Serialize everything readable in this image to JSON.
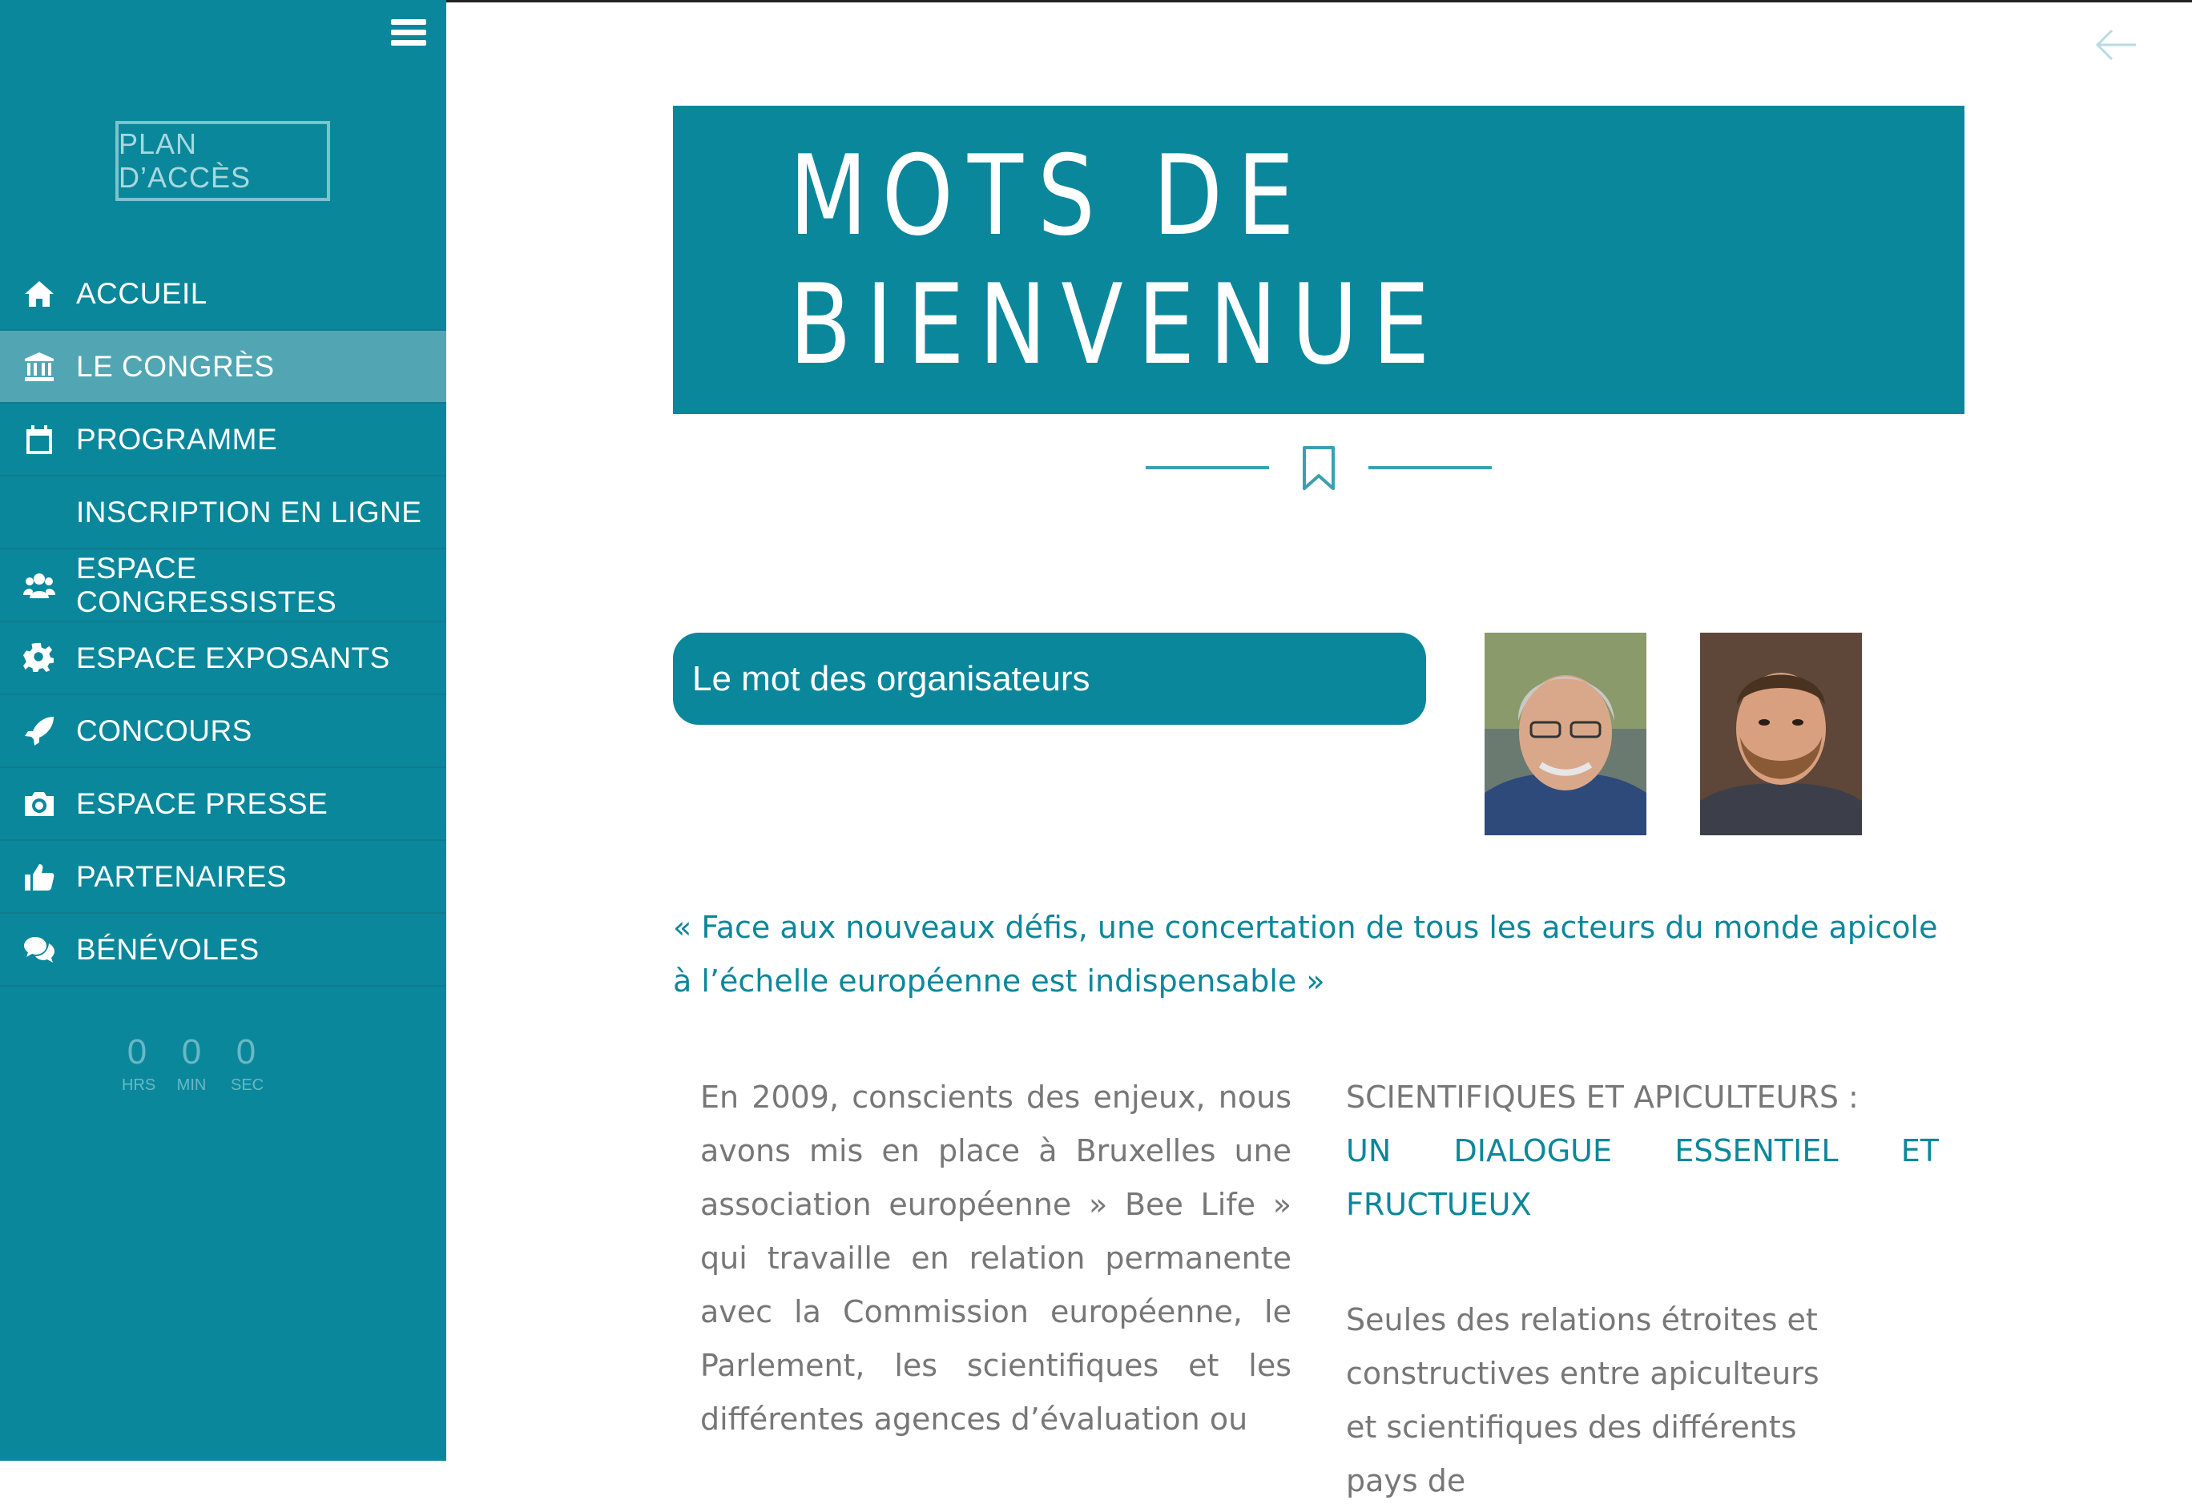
{
  "sidebar": {
    "plan_button": "PLAN D’ACCÈS",
    "items": [
      {
        "label": "ACCUEIL",
        "icon": "home-icon",
        "active": false
      },
      {
        "label": "LE CONGRÈS",
        "icon": "institution-icon",
        "active": true
      },
      {
        "label": "PROGRAMME",
        "icon": "calendar-icon",
        "active": false
      },
      {
        "label": "INSCRIPTION EN LIGNE",
        "icon": "",
        "active": false
      },
      {
        "label": "ESPACE CONGRESSISTES",
        "icon": "users-icon",
        "active": false
      },
      {
        "label": "ESPACE EXPOSANTS",
        "icon": "gear-icon",
        "active": false
      },
      {
        "label": "CONCOURS",
        "icon": "rocket-icon",
        "active": false
      },
      {
        "label": "ESPACE PRESSE",
        "icon": "camera-icon",
        "active": false
      },
      {
        "label": "PARTENAIRES",
        "icon": "thumbs-up-icon",
        "active": false
      },
      {
        "label": "BÉNÉVOLES",
        "icon": "chat-bubbles-icon",
        "active": false
      }
    ],
    "countdown": {
      "hours": "0",
      "hours_label": "HRS",
      "minutes": "0",
      "minutes_label": "MIN",
      "seconds": "0",
      "seconds_label": "SEC"
    }
  },
  "main": {
    "page_title": "MOTS DE BIENVENUE",
    "section_title": "Le mot des organisateurs",
    "quote": "« Face aux nouveaux défis, une concertation de tous les acteurs du monde apicole à l’échelle européenne est indispensable »",
    "left_column": "En 2009, conscients des enjeux, nous avons mis en place à Bruxelles une association européenne » Bee Life » qui travaille en relation permanente avec la Commission européenne, le Parlement, les scientifiques et les différentes agences d’évaluation ou",
    "right_column": {
      "heading_1": "SCIENTIFIQUES ET APICULTEURS :",
      "heading_2": "UN DIALOGUE ESSENTIEL ET FRUCTUEUX",
      "body": "Seules des relations étroites et constructives entre apiculteurs et scientifiques des différents pays de"
    }
  },
  "colors": {
    "brand": "#0b879b",
    "sidebar_active": "#52a6b3",
    "body_text": "#777777"
  }
}
